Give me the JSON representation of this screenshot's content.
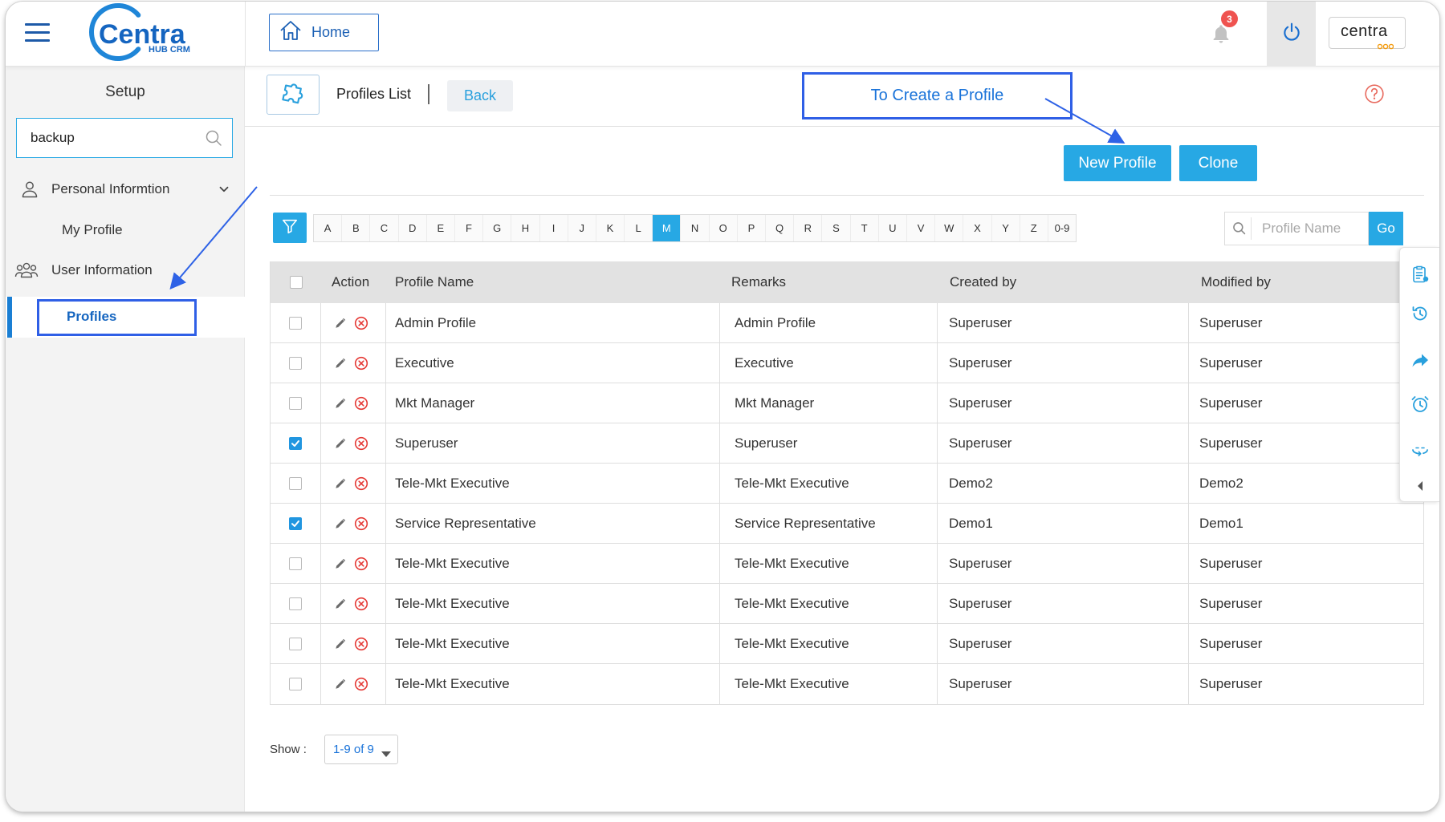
{
  "header": {
    "logo_text": "Centra",
    "logo_sub": "HUB CRM",
    "home_label": "Home",
    "notification_count": "3",
    "brand_right": "centra"
  },
  "sidebar": {
    "title": "Setup",
    "search_value": "backup",
    "items": [
      {
        "label": "Personal Informtion",
        "icon": "user-icon",
        "expandable": true
      },
      {
        "label": "My Profile"
      },
      {
        "label": "User Information",
        "icon": "users-icon"
      },
      {
        "label": "Profiles",
        "active": true
      }
    ]
  },
  "toolbar": {
    "title": "Profiles List",
    "back_label": "Back",
    "callout": "To Create a Profile",
    "new_profile_label": "New Profile",
    "clone_label": "Clone"
  },
  "alphabet": {
    "letters": [
      "A",
      "B",
      "C",
      "D",
      "E",
      "F",
      "G",
      "H",
      "I",
      "J",
      "K",
      "L",
      "M",
      "N",
      "O",
      "P",
      "Q",
      "R",
      "S",
      "T",
      "U",
      "V",
      "W",
      "X",
      "Y",
      "Z",
      "0-9"
    ],
    "active": "M"
  },
  "search": {
    "placeholder": "Profile Name",
    "go_label": "Go"
  },
  "table": {
    "columns": [
      "Action",
      "Profile Name",
      "Remarks",
      "Created by",
      "Modified by"
    ],
    "rows": [
      {
        "name": "Admin Profile",
        "remarks": "Admin Profile",
        "created_by": "Superuser",
        "modified_by": "Superuser",
        "checked": false
      },
      {
        "name": "Executive",
        "remarks": "Executive",
        "created_by": "Superuser",
        "modified_by": "Superuser",
        "checked": false
      },
      {
        "name": "Mkt Manager",
        "remarks": "Mkt Manager",
        "created_by": "Superuser",
        "modified_by": "Superuser",
        "checked": false
      },
      {
        "name": "Superuser",
        "remarks": "Superuser",
        "created_by": "Superuser",
        "modified_by": "Superuser",
        "checked": true
      },
      {
        "name": "Tele-Mkt Executive",
        "remarks": "Tele-Mkt Executive",
        "created_by": "Demo2",
        "modified_by": "Demo2",
        "checked": false
      },
      {
        "name": "Service Representative",
        "remarks": "Service Representative",
        "created_by": "Demo1",
        "modified_by": "Demo1",
        "checked": true
      },
      {
        "name": "Tele-Mkt Executive",
        "remarks": "Tele-Mkt Executive",
        "created_by": "Superuser",
        "modified_by": "Superuser",
        "checked": false
      },
      {
        "name": "Tele-Mkt Executive",
        "remarks": "Tele-Mkt Executive",
        "created_by": "Superuser",
        "modified_by": "Superuser",
        "checked": false
      },
      {
        "name": "Tele-Mkt Executive",
        "remarks": "Tele-Mkt Executive",
        "created_by": "Superuser",
        "modified_by": "Superuser",
        "checked": false
      },
      {
        "name": "Tele-Mkt Executive",
        "remarks": "Tele-Mkt Executive",
        "created_by": "Superuser",
        "modified_by": "Superuser",
        "checked": false
      }
    ]
  },
  "pager": {
    "show_label": "Show :",
    "value": "1-9 of 9"
  },
  "icons": {
    "header": [
      "menu-icon",
      "home-icon",
      "bell-icon",
      "power-icon"
    ],
    "toolbar": [
      "puzzle-icon",
      "help-icon",
      "filter-icon",
      "search-icon"
    ],
    "row_actions": [
      "edit-icon",
      "delete-icon"
    ],
    "side_tools": [
      "clipboard-icon",
      "history-icon",
      "share-icon",
      "alarm-icon",
      "360-view-icon",
      "chevron-left-icon"
    ]
  },
  "colors": {
    "accent": "#27a8e4",
    "brand": "#1565c0",
    "annotation": "#2f5fe6",
    "danger": "#e53935",
    "badge": "#ef5350"
  }
}
